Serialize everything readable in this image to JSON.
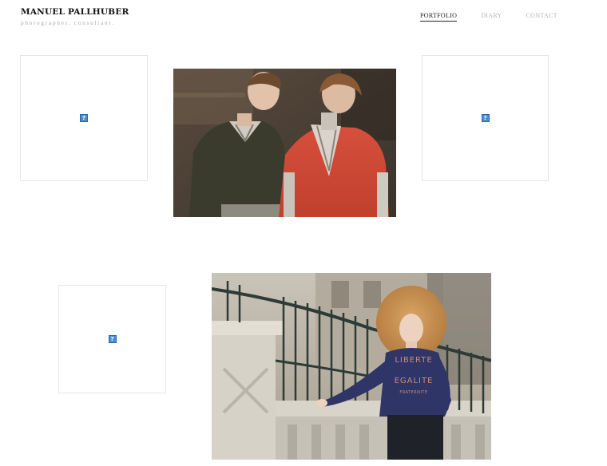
{
  "brand": {
    "name": "MANUEL PALLHUBER",
    "tagline": "photographer. consultant."
  },
  "nav": {
    "items": [
      {
        "label": "PORTFOLIO",
        "active": true
      },
      {
        "label": "DIARY",
        "active": false
      },
      {
        "label": "CONTACT",
        "active": false
      }
    ]
  },
  "gallery": {
    "broken_image_glyph": "?",
    "photo_1_subject": "two-male-models-photo",
    "photo_2_subject": "woman-curly-hair-liberte-sweater-photo",
    "photo_2_shirt_lines": [
      "LIBERTE",
      "EGALITE",
      "FRATERNITE"
    ]
  }
}
